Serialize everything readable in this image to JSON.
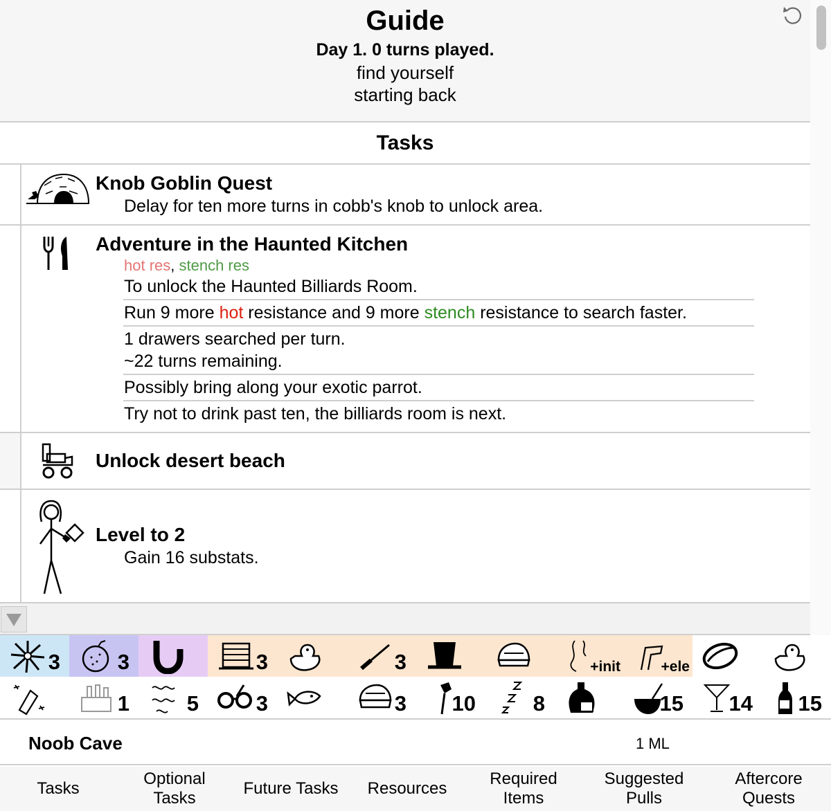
{
  "header": {
    "title": "Guide",
    "day_line": "Day 1. 0 turns played.",
    "subtitle_1": "find yourself",
    "subtitle_2": "starting back",
    "reset_icon": "undo-arrow-icon"
  },
  "tasks_section": {
    "heading": "Tasks",
    "tasks": [
      {
        "icon": "goblin-cave-icon",
        "title": "Knob Goblin Quest",
        "lines": [
          "Delay for ten more turns in cobb's knob to unlock area."
        ]
      },
      {
        "icon": "fork-knife-icon",
        "title": "Adventure in the Haunted Kitchen",
        "res_tags": {
          "hot": "hot res",
          "sep": ", ",
          "stench": "stench res"
        },
        "line_unlock": "To unlock the Haunted Billiards Room.",
        "line_run": {
          "p1": "Run 9 more ",
          "hot": "hot",
          "p2": " resistance and 9 more ",
          "stench": "stench",
          "p3": " resistance to search faster."
        },
        "line_drawers": "1 drawers searched per turn.",
        "line_turns": "~22 turns remaining.",
        "line_parrot": "Possibly bring along your exotic parrot.",
        "line_drink": "Try not to drink past ten, the billiards room is next."
      },
      {
        "icon": "scooter-icon",
        "title": "Unlock desert beach"
      },
      {
        "icon": "stick-figure-icon",
        "title": "Level to 2",
        "lines": [
          "Gain 16 substats."
        ]
      }
    ]
  },
  "resources": {
    "row1": [
      {
        "icon": "sparkle-burst-icon",
        "count": "3",
        "bg": "#cde6f6"
      },
      {
        "icon": "bomb-icon",
        "count": "3",
        "bg": "#c8c4f2"
      },
      {
        "icon": "horseshoe-icon",
        "count": "",
        "bg": "#e6ccf5"
      },
      {
        "icon": "abacus-icon",
        "count": "3",
        "bg": "#fde6cf"
      },
      {
        "icon": "rubber-duck-icon",
        "count": "",
        "bg": "#fde6cf"
      },
      {
        "icon": "knife-icon",
        "count": "3",
        "bg": "#fde6cf"
      },
      {
        "icon": "top-hat-icon",
        "count": "",
        "bg": "#fde6cf"
      },
      {
        "icon": "helmet-icon",
        "count": "",
        "bg": "#fde6cf"
      },
      {
        "icon": "wavy-lines-icon",
        "count": "+init",
        "bg": "#fde6cf"
      },
      {
        "icon": "pipe-icon",
        "count": "+ele",
        "bg": "#fde6cf"
      },
      {
        "icon": "hot-dog-icon",
        "count": "",
        "bg": "#ffffff"
      },
      {
        "icon": "rubber-duck-icon",
        "count": "",
        "bg": "#ffffff"
      }
    ],
    "row2": [
      {
        "icon": "crystal-icon",
        "count": ""
      },
      {
        "icon": "castle-icon",
        "count": "1"
      },
      {
        "icon": "wave-icon",
        "count": "5"
      },
      {
        "icon": "glasses-icon",
        "count": "3"
      },
      {
        "icon": "fish-icon",
        "count": ""
      },
      {
        "icon": "helmet-icon",
        "count": "3"
      },
      {
        "icon": "rose-icon",
        "count": "10"
      },
      {
        "icon": "sleep-z-icon",
        "count": "8"
      },
      {
        "icon": "potion-bottle-icon",
        "count": ""
      },
      {
        "icon": "bowl-icon",
        "count": "15"
      },
      {
        "icon": "martini-icon",
        "count": "14"
      },
      {
        "icon": "liquor-bottle-icon",
        "count": "15"
      }
    ]
  },
  "location": {
    "name": "Noob Cave",
    "ml": "1 ML"
  },
  "tabs": [
    {
      "label": "Tasks"
    },
    {
      "label": "Optional Tasks"
    },
    {
      "label": "Future Tasks"
    },
    {
      "label": "Resources"
    },
    {
      "label": "Required Items"
    },
    {
      "label": "Suggested Pulls"
    },
    {
      "label": "Aftercore Quests"
    }
  ]
}
